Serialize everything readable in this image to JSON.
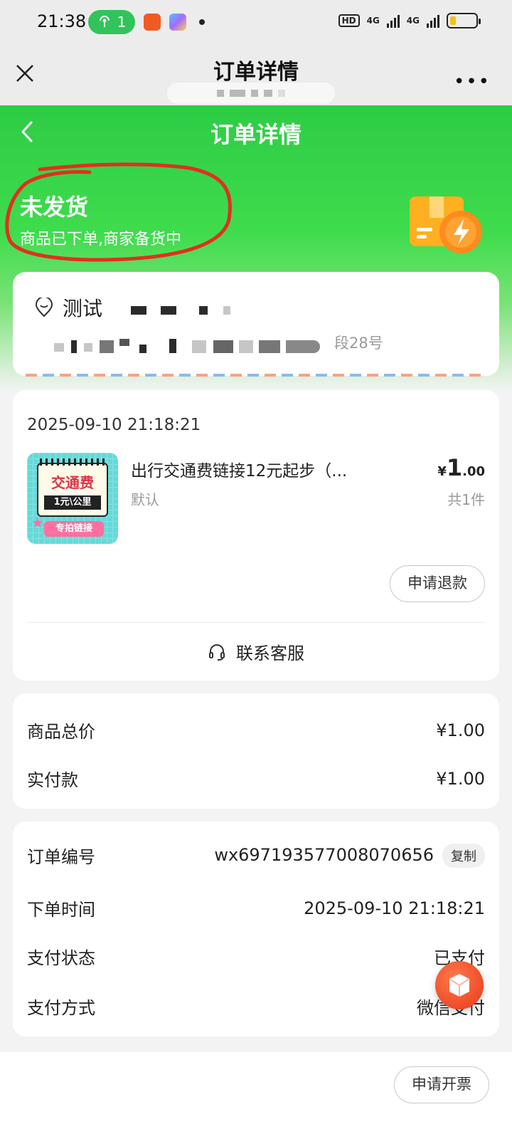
{
  "status_bar": {
    "time": "21:38",
    "hotspot_count": "1",
    "hd_label": "HD",
    "sig1_label": "4G",
    "sig2_label": "4G"
  },
  "webview": {
    "title": "订单详情",
    "more_label": "•••"
  },
  "header": {
    "title": "订单详情",
    "status": "未发货",
    "status_note": "商品已下单,商家备货中"
  },
  "address": {
    "name": "测试",
    "line_suffix": "段28号"
  },
  "order": {
    "time": "2025-09-10 21:18:21",
    "thumb": {
      "title": "交通费",
      "subtitle": "1元\\公里",
      "tag": "专拍链接"
    },
    "product_name": "出行交通费链接12元起步（...",
    "sku": "默认",
    "price_currency": "¥",
    "price_int": "1",
    "price_dec": ".00",
    "quantity": "共1件",
    "refund_label": "申请退款",
    "service_label": "联系客服"
  },
  "price_summary": {
    "items": [
      {
        "label": "商品总价",
        "value": "¥1.00"
      },
      {
        "label": "实付款",
        "value": "¥1.00"
      }
    ]
  },
  "order_info": {
    "order_no_label": "订单编号",
    "order_no": "wx697193577008070656",
    "copy_label": "复制",
    "time_label": "下单时间",
    "time_value": "2025-09-10 21:18:21",
    "pay_status_label": "支付状态",
    "pay_status": "已支付",
    "pay_method_label": "支付方式",
    "pay_method": "微信支付"
  },
  "bottom": {
    "invoice_label": "申请开票"
  },
  "colors": {
    "header_green": "#2dcc45",
    "annotation_red": "#e0301e",
    "fab_orange": "#e8371a"
  }
}
